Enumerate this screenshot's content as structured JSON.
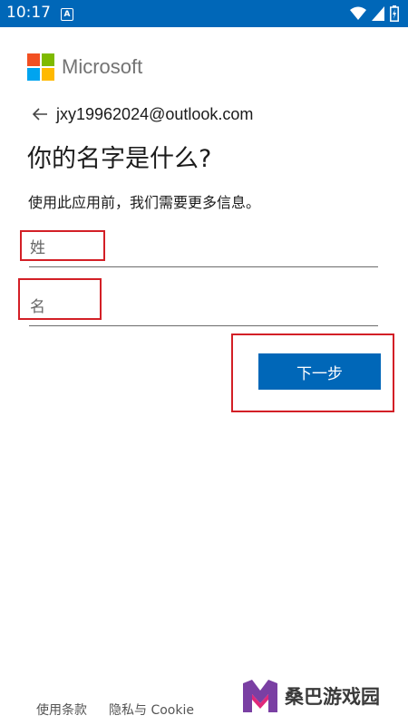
{
  "status_bar": {
    "time": "10:17",
    "notification_letter": "A"
  },
  "brand": {
    "name": "Microsoft",
    "colors": [
      "#f25022",
      "#7fba00",
      "#00a4ef",
      "#ffb900"
    ]
  },
  "account": {
    "email": "jxy19962024@outlook.com"
  },
  "page": {
    "title": "你的名字是什么?",
    "subtitle": "使用此应用前，我们需要更多信息。"
  },
  "form": {
    "last_name_placeholder": "姓",
    "last_name_value": "",
    "first_name_placeholder": "名",
    "first_name_value": ""
  },
  "actions": {
    "next_label": "下一步"
  },
  "footer": {
    "terms": "使用条款",
    "privacy": "隐私与 Cookie"
  },
  "watermark": {
    "text": "桑巴游戏园"
  },
  "colors": {
    "accent": "#0067b8",
    "highlight": "#d31f26"
  }
}
